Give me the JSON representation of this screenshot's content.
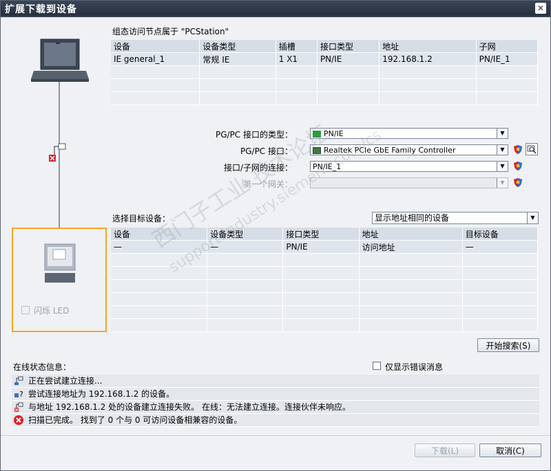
{
  "window": {
    "title": "扩展下载到设备",
    "close_icon": "close-icon"
  },
  "access_node": {
    "heading": "组态访问节点属于 \"PCStation\"",
    "columns": [
      "设备",
      "设备类型",
      "插槽",
      "接口类型",
      "地址",
      "子网"
    ],
    "rows": [
      [
        "IE general_1",
        "常规 IE",
        "1 X1",
        "PN/IE",
        "192.168.1.2",
        "PN/IE_1"
      ]
    ]
  },
  "pgpc": {
    "type_label": "PG/PC 接口的类型：",
    "type_value": "PN/IE",
    "iface_label": "PG/PC 接口：",
    "iface_value": "Realtek PCIe GbE Family Controller",
    "conn_label": "接口/子网的连接：",
    "conn_value": "PN/IE_1",
    "gateway_label": "第一个网关：",
    "gateway_value": ""
  },
  "target": {
    "label": "选择目标设备：",
    "filter_value": "显示地址相同的设备",
    "columns": [
      "设备",
      "设备类型",
      "接口类型",
      "地址",
      "目标设备"
    ],
    "rows": [
      [
        "—",
        "—",
        "PN/IE",
        "访问地址",
        "—"
      ]
    ]
  },
  "flash_led_label": "闪烁 LED",
  "search_button": "开始搜索(S)",
  "status": {
    "heading": "在线状态信息：",
    "only_errors_label": "仅显示错误消息",
    "messages": [
      "正在尝试建立连接...",
      "尝试连接地址为 192.168.1.2 的设备。",
      "与地址 192.168.1.2 处的设备建立连接失败。 在线：无法建立连接。连接伙伴未响应。",
      "扫描已完成。 找到了 0 个与 0 可访问设备相兼容的设备。"
    ]
  },
  "buttons": {
    "download": "下载(L)",
    "cancel": "取消(C)"
  },
  "watermark": {
    "line1": "西门子工业  技术论坛",
    "line2": "support.industry.siemens.com/cs"
  },
  "colors": {
    "highlight_border": "#f5a623",
    "titlebar": "#2e3949",
    "error_red": "#d8202a"
  }
}
